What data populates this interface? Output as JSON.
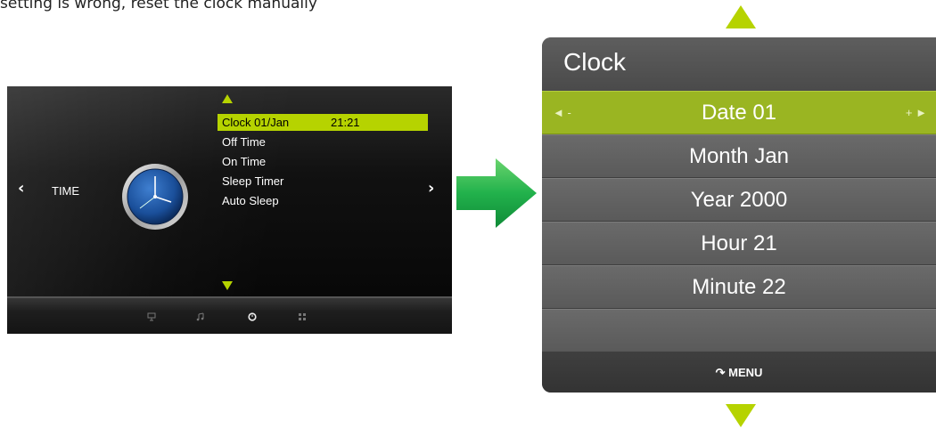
{
  "caption": "setting is wrong, reset the clock manually",
  "tv_menu": {
    "nav_left": "‹",
    "nav_right": "›",
    "section": "TIME",
    "items": [
      {
        "label": "Clock  01/Jan",
        "value": "21:21",
        "selected": true
      },
      {
        "label": "Off Time",
        "value": ""
      },
      {
        "label": "On Time",
        "value": ""
      },
      {
        "label": "Sleep Timer",
        "value": ""
      },
      {
        "label": "Auto Sleep",
        "value": ""
      }
    ],
    "bottom_icons": [
      "monitor-icon",
      "music-icon",
      "clock-icon",
      "grid-icon"
    ],
    "active_icon": "clock-icon"
  },
  "clock_panel": {
    "title": "Clock",
    "rows": [
      {
        "label": "Date 01",
        "selected": true,
        "left_control": "◄  -",
        "right_control": "+  ►"
      },
      {
        "label": "Month Jan"
      },
      {
        "label": "Year 2000"
      },
      {
        "label": "Hour 21"
      },
      {
        "label": "Minute 22"
      },
      {
        "label": ""
      }
    ],
    "footer": "MENU"
  },
  "colors": {
    "accent": "#b6d300",
    "arrow_green": "#22b24c",
    "panel_bg": "#4f4f4f",
    "selected_row": "#9ab522"
  }
}
